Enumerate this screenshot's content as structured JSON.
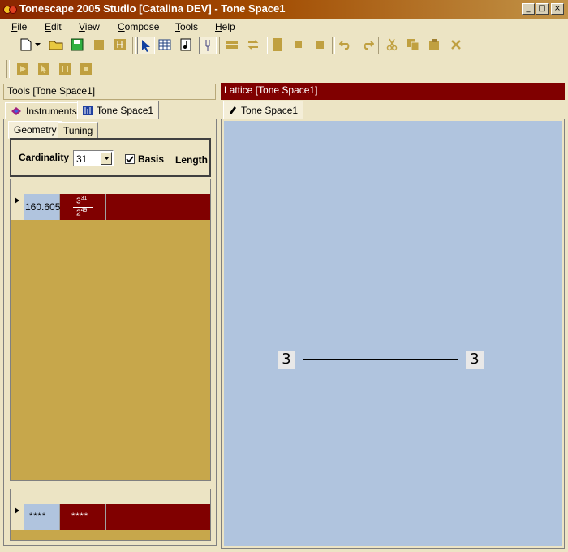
{
  "window": {
    "title": "Tonescape 2005 Studio [Catalina DEV]  -  Tone Space1",
    "controls": {
      "minimize": "_",
      "maximize": "□",
      "close": "×"
    }
  },
  "menubar": [
    {
      "label": "File"
    },
    {
      "label": "Edit"
    },
    {
      "label": "View"
    },
    {
      "label": "Compose"
    },
    {
      "label": "Tools"
    },
    {
      "label": "Help"
    }
  ],
  "tools_panel": {
    "header": "Tools  [Tone Space1]",
    "tabs": [
      {
        "label": "Instruments"
      },
      {
        "label": "Tone Space1"
      }
    ],
    "subtabs": [
      {
        "label": "Geometry"
      },
      {
        "label": "Tuning"
      }
    ],
    "cardinality_label": "Cardinality",
    "cardinality_value": "31",
    "basis_label": "Basis",
    "basis_checked": true,
    "length_label": "Length",
    "grid_rows": [
      {
        "cents": "160.605",
        "ratio_num": "3",
        "ratio_num_exp": "31",
        "ratio_den": "2",
        "ratio_den_exp": "49"
      }
    ],
    "new_row": {
      "c1": "****",
      "c2": "****"
    }
  },
  "lattice_panel": {
    "header": "Lattice  [Tone Space1]",
    "tab": "Tone Space1",
    "nodes": [
      {
        "label": "3"
      },
      {
        "label": "3"
      }
    ]
  },
  "colors": {
    "accent_dark_red": "#800000",
    "panel_gold": "#c7a74b",
    "lattice_bg": "#b0c4de",
    "title_gradient_start": "#8a2600"
  }
}
